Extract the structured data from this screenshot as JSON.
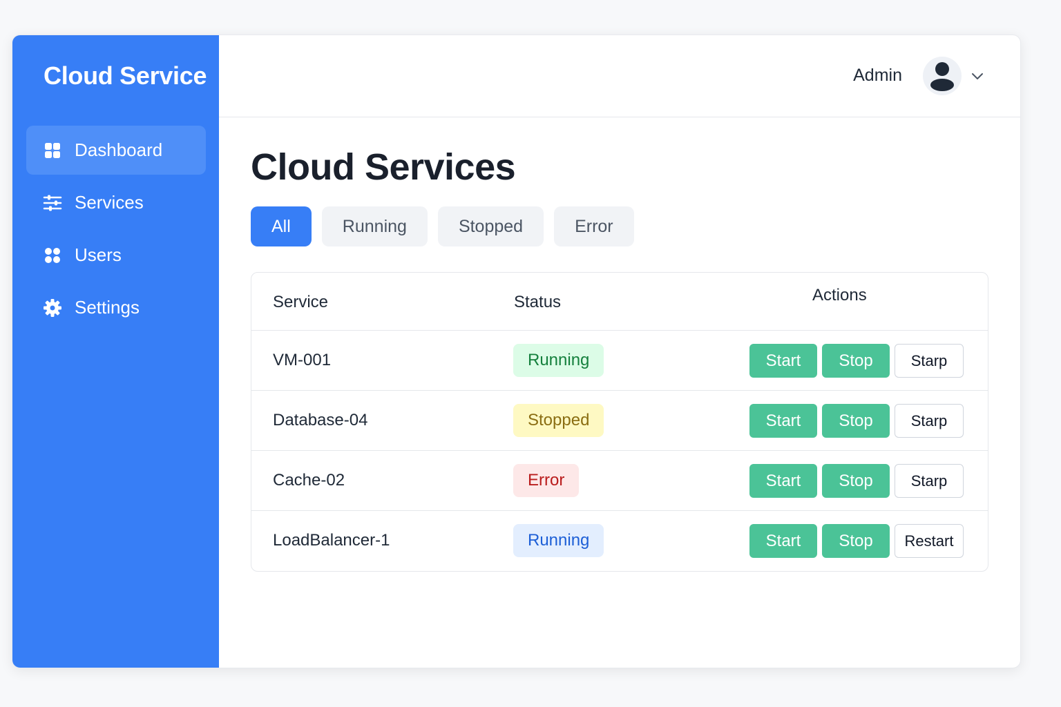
{
  "sidebar": {
    "brand": "Cloud Service",
    "items": [
      {
        "label": "Dashboard",
        "icon": "dashboard-icon",
        "active": true
      },
      {
        "label": "Services",
        "icon": "sliders-icon",
        "active": false
      },
      {
        "label": "Users",
        "icon": "users-icon",
        "active": false
      },
      {
        "label": "Settings",
        "icon": "gear-icon",
        "active": false
      }
    ]
  },
  "header": {
    "user_name": "Admin",
    "avatar_icon": "user-avatar-icon",
    "menu_icon": "chevron-down-icon"
  },
  "main": {
    "title": "Cloud Services",
    "filters": [
      {
        "label": "All",
        "active": true
      },
      {
        "label": "Running",
        "active": false
      },
      {
        "label": "Stopped",
        "active": false
      },
      {
        "label": "Error",
        "active": false
      }
    ],
    "table": {
      "columns": [
        "Service",
        "Status",
        "Actions"
      ],
      "rows": [
        {
          "service": "VM-001",
          "status": "Running",
          "actions": [
            "Start",
            "Stop",
            "Starp"
          ]
        },
        {
          "service": "Database-04",
          "status": "Stopped",
          "actions": [
            "Start",
            "Stop",
            "Starp"
          ]
        },
        {
          "service": "Cache-02",
          "status": "Error",
          "actions": [
            "Start",
            "Stop",
            "Starp"
          ]
        },
        {
          "service": "LoadBalancer-1",
          "status": "Running",
          "actions": [
            "Start",
            "Stop",
            "Restart"
          ]
        }
      ]
    }
  },
  "colors": {
    "primary": "#377ef6",
    "action_green": "#4bc397",
    "running_bg": "#dcfce7",
    "stopped_bg": "#fef9c3",
    "error_bg": "#fde8e8",
    "info_bg": "#e3eefe"
  }
}
